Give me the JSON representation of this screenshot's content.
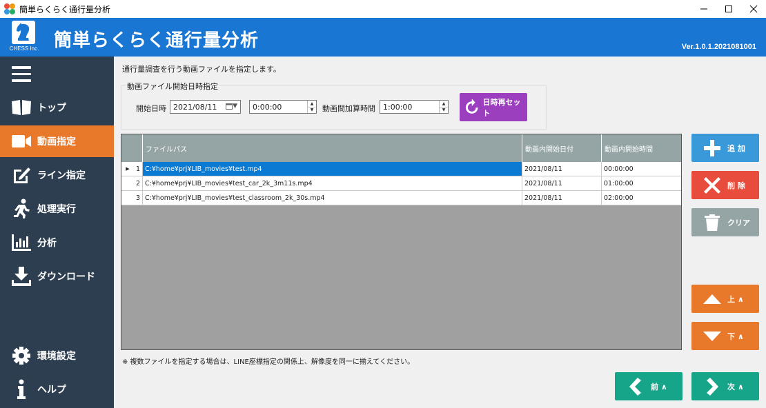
{
  "window": {
    "title": "簡単らくらく通行量分析"
  },
  "header": {
    "logo_text": "CHESS Inc.",
    "title": "簡単らくらく通行量分析",
    "version": "Ver.1.0.1.2021081001"
  },
  "sidebar": {
    "items": [
      {
        "label": "トップ",
        "icon": "book-icon"
      },
      {
        "label": "動画指定",
        "icon": "video-camera-icon",
        "active": true
      },
      {
        "label": "ライン指定",
        "icon": "edit-icon"
      },
      {
        "label": "処理実行",
        "icon": "running-icon"
      },
      {
        "label": "分析",
        "icon": "bar-chart-icon"
      },
      {
        "label": "ダウンロード",
        "icon": "download-icon"
      },
      {
        "label": "環境設定",
        "icon": "gear-icon"
      },
      {
        "label": "ヘルプ",
        "icon": "info-icon"
      }
    ]
  },
  "main": {
    "instruction": "通行量調査を行う動画ファイルを指定します。",
    "group": {
      "title": "動画ファイル開始日時指定",
      "start_label": "開始日時",
      "start_date": "2021/08/11",
      "start_time": "0:00:00",
      "interval_label": "動画間加算時間",
      "interval_value": "1:00:00",
      "reset_button": "日時再セット"
    },
    "grid": {
      "columns": [
        "ファイルパス",
        "動画内開始日付",
        "動画内開始時間"
      ],
      "rows": [
        {
          "index": "1",
          "path": "C:¥home¥prj¥LIB_movies¥test.mp4",
          "date": "2021/08/11",
          "time": "00:00:00",
          "selected": true
        },
        {
          "index": "2",
          "path": "C:¥home¥prj¥LIB_movies¥test_car_2k_3m11s.mp4",
          "date": "2021/08/11",
          "time": "01:00:00"
        },
        {
          "index": "3",
          "path": "C:¥home¥prj¥LIB_movies¥test_classroom_2k_30s.mp4",
          "date": "2021/08/11",
          "time": "02:00:00"
        }
      ]
    },
    "note": "※ 複数ファイルを指定する場合は、LINE座標指定の関係上、解像度を同一に揃えてください。"
  },
  "actions": {
    "add": "追 加",
    "delete": "削 除",
    "clear": "クリア",
    "up": "上 ∧",
    "down": "下 ∧",
    "prev": "前 ∧",
    "next": "次 ∧"
  },
  "colors": {
    "header": "#1976d2",
    "sidebar": "#2d3e50",
    "active": "#e8782a",
    "add": "#3a9ad9",
    "delete": "#e74c3c",
    "clear": "#95a5a6",
    "move": "#e8782a",
    "nav": "#17a589",
    "reset": "#9b3fbf"
  }
}
